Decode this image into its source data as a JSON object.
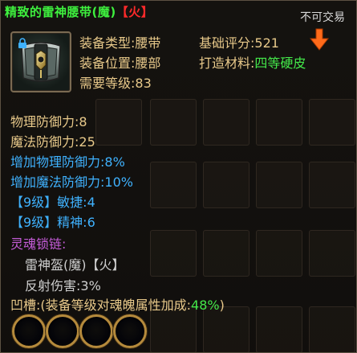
{
  "item": {
    "name": "精致的雷神腰带(魔)",
    "element_tag": "【火】",
    "trade_status": "不可交易",
    "icon": "armored-belt-icon"
  },
  "attributes": {
    "type_label": "装备类型:",
    "type_value": "腰带",
    "slot_label": "装备位置:",
    "slot_value": "腰部",
    "level_label": "需要等级:",
    "level_value": "83",
    "score_label": "基础评分:",
    "score_value": "521",
    "material_label": "打造材料:",
    "material_value": "四等硬皮",
    "score_trend_icon": "down-arrow-icon"
  },
  "stats": {
    "phys_def": "物理防御力:8",
    "mag_def": "魔法防御力:25",
    "add_phys_def": "增加物理防御力:8%",
    "add_mag_def": "增加魔法防御力:10%",
    "agility": "【9级】敏捷:4",
    "spirit": "【9级】精神:6"
  },
  "soul_chain": {
    "label": "灵魂锁链:",
    "item": "雷神盔(魔)【火】",
    "effect": "反射伤害:3%"
  },
  "sockets": {
    "label": "凹槽:",
    "note": "(装备等级对魂魄属性加成:",
    "bonus": "48%",
    "close": ")",
    "count": 4
  },
  "colors": {
    "name": "#3ef03e",
    "element": "#ff2a2a",
    "label": "#e8c98a",
    "bonus_stat": "#3fb2ff",
    "soul_chain": "#c65dd9",
    "socket_ring": "#b58a3c"
  }
}
